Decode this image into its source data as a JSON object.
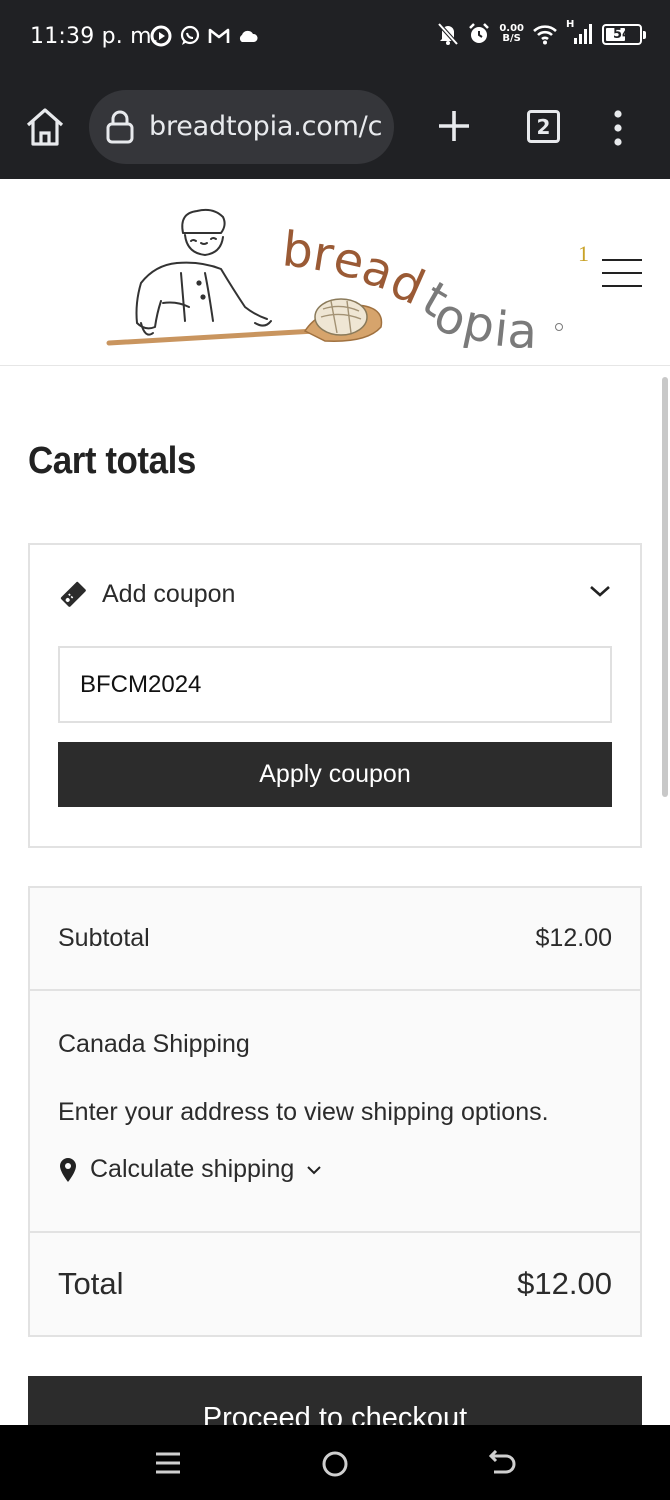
{
  "status_bar": {
    "time": "11:39 p. m.",
    "net_speed_value": "0.00",
    "net_speed_unit": "B/S",
    "network_type": "H",
    "battery": "54",
    "battery_level_percent": 54,
    "left_icons": [
      "app-notification-icon",
      "whatsapp-icon",
      "gmail-icon",
      "cloud-icon"
    ],
    "right_icons": [
      "mute-icon",
      "alarm-icon",
      "wifi-icon",
      "signal-icon",
      "battery-icon"
    ]
  },
  "browser": {
    "url": "breadtopia.com/c",
    "tab_count": "2"
  },
  "header": {
    "logo_alt": "breadtopia",
    "cart_count": "1"
  },
  "page": {
    "title": "Cart totals"
  },
  "coupon": {
    "label": "Add coupon",
    "input_value": "BFCM2024",
    "apply_label": "Apply coupon"
  },
  "totals": {
    "subtotal_label": "Subtotal",
    "subtotal_value": "$12.00",
    "shipping_title": "Canada Shipping",
    "shipping_note": "Enter your address to view shipping options.",
    "calc_shipping_label": "Calculate shipping",
    "total_label": "Total",
    "total_value": "$12.00"
  },
  "checkout": {
    "label": "Proceed to checkout"
  },
  "colors": {
    "browser_bg": "#202124",
    "url_pill": "#35363a",
    "button_dark": "#2c2c2c",
    "cart_count": "#c9a227",
    "logo_brown": "#9a5a35",
    "logo_gray": "#7a7a7a"
  }
}
